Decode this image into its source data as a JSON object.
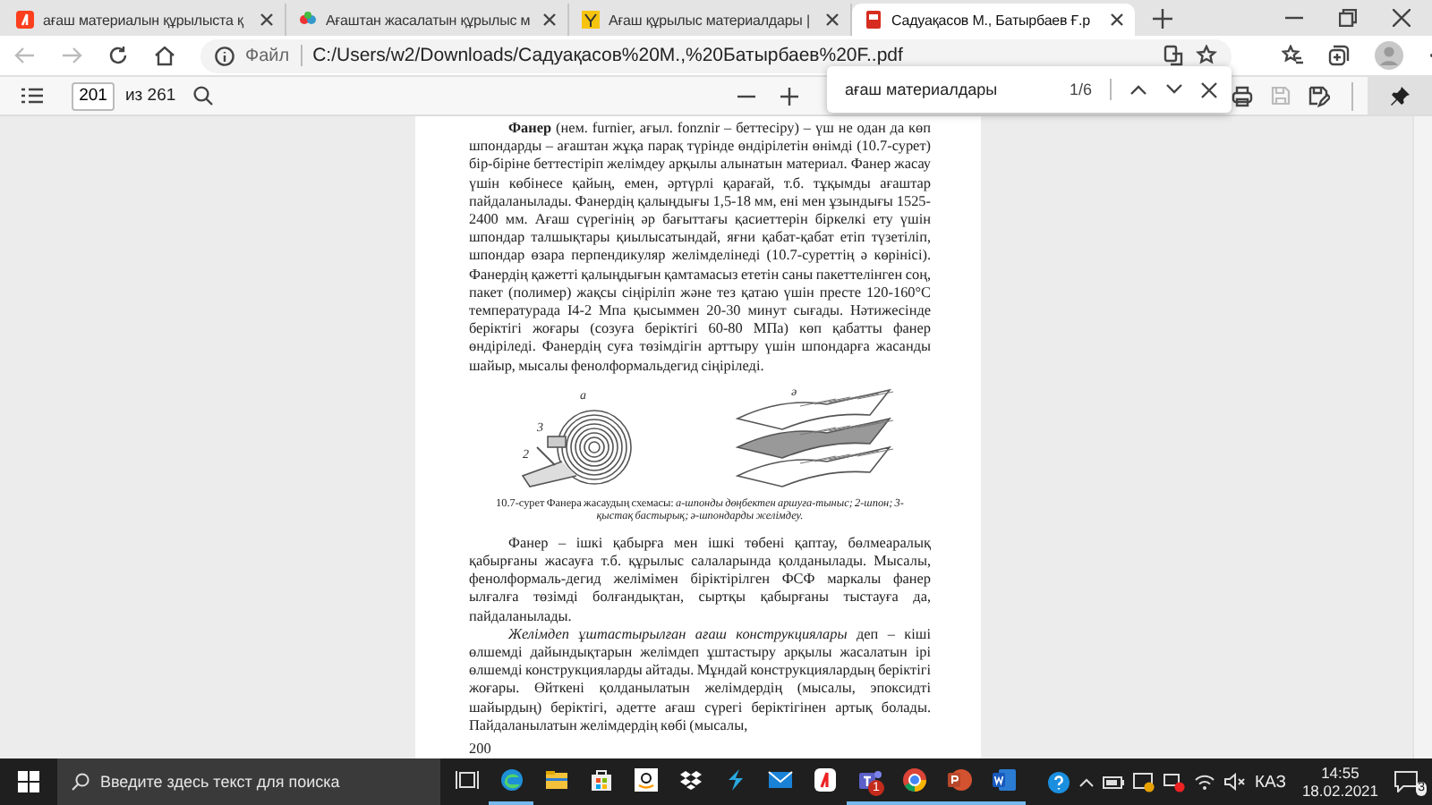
{
  "tabs": [
    {
      "kind": "yandex",
      "label": "ағаш материалын құрылыста қ",
      "selected": false
    },
    {
      "kind": "site",
      "label": "Ағаштан жасалатын құрылыс м",
      "selected": false
    },
    {
      "kind": "doc",
      "label": "Ағаш құрылыс материалдары |",
      "selected": false
    },
    {
      "kind": "pdf",
      "label": "Садуақасов М., Батырбаев Ғ.р",
      "selected": true
    }
  ],
  "address_bar": {
    "scheme_label": "Файл",
    "url": "C:/Users/w2/Downloads/Садуақасов%20М.,%20Батырбаев%20F..pdf"
  },
  "pdf_toolbar": {
    "page": "201",
    "page_total": "из 261"
  },
  "find_bar": {
    "query": "ағаш материалдары",
    "match_count": "1/6"
  },
  "document": {
    "paragraphs": [
      "**Фанер** (нем. furnier, ағыл. fonznir – беттесіру) – үш не одан да көп шпондарды – ағаштан жұқа парақ түрінде өндірілетін өнімді (10.7-сурет) бір-біріне беттестіріп желімдеу арқылы алынатын материал. Фанер жасау үшін көбінесе қайың, емен, әртүрлі қарағай, т.б. тұқымды ағаштар пайдаланылады. Фанердің қалыңдығы 1,5-18 мм, ені мен ұзындығы 1525-2400 мм. Ағаш сүрегінің әр бағыттағы қасиеттерін біркелкі ету үшін шпондар талшықтары қиылысатындай, яғни қабат-қабат етіп түзетіліп, шпондар өзара перпендикуляр желімделінеді (10.7-суреттің ә көрінісі). Фанердің қажетті қалыңдығын қамтамасыз ететін саны пакеттелінген соң, пакет (полимер) жақсы сіңіріліп және тез қатаю үшін престе 120-160°C температурада І4-2 Мпа қысыммен 20-30 минут сығады. Нәтижесінде беріктігі жоғары (созуға беріктігі 60-80 МПа) көп қабатты фанер өндіріледі. Фанердің суға төзімдігін арттыру үшін шпондарға жасанды шайыр, мысалы фенолформальдегид сіңіріледі."
    ],
    "figure": {
      "labels": [
        "а",
        "ә",
        "3",
        "2"
      ],
      "caption": "10.7-сурет Фанера жасаудың схемасы: *а-шпонды дөңбектен аршуға-тыныс; 2-шпон; 3-қыстақ бастырық; ә-шпондарды желімдеу.*"
    },
    "paragraphs_after": [
      "Фанер – ішкі қабырға мен ішкі төбені қаптау, бөлмеаралық қабырғаны жасауға т.б. құрылыс салаларында қолданылады. Мысалы, фенолформаль-дегид желімімен біріктірілген ФСФ маркалы фанер ылғалға төзімді болғандықтан, сыртқы қабырғаны тыстауға да, пайдаланылады.",
      "*Желімдеп ұштастырылған ағаш конструкциялары* деп – кіші өлшемді дайындықтарын желімдеп ұштастыру арқылы жасалатын ірі өлшемді конструкцияларды айтады. Мұндай конструкциялардың беріктігі жоғары. Өйткені қолданылатын желімдердің (мысалы, эпоксидті шайырдың) беріктігі, әдетте ағаш сүрегі беріктігінен артық болады. Пайдаланылатын желімдердің көбі (мысалы,"
    ],
    "page_number": "200"
  },
  "taskbar": {
    "search_placeholder": "Введите здесь текст для поиска",
    "apps": [
      {
        "kind": "taskview",
        "running": false
      },
      {
        "kind": "edge",
        "running": true
      },
      {
        "kind": "explorer",
        "running": false
      },
      {
        "kind": "store",
        "running": false
      },
      {
        "kind": "amazon",
        "running": false
      },
      {
        "kind": "dropbox",
        "running": false
      },
      {
        "kind": "bolt",
        "running": false
      },
      {
        "kind": "mail",
        "running": false
      },
      {
        "kind": "yandex",
        "running": false
      },
      {
        "kind": "teams",
        "running": true,
        "badge": "1"
      },
      {
        "kind": "chrome",
        "running": true
      },
      {
        "kind": "powerpoint",
        "running": true
      },
      {
        "kind": "word",
        "running": true
      }
    ],
    "language": "КАЗ",
    "time": "14:55",
    "date": "18.02.2021",
    "notifications": "3"
  }
}
